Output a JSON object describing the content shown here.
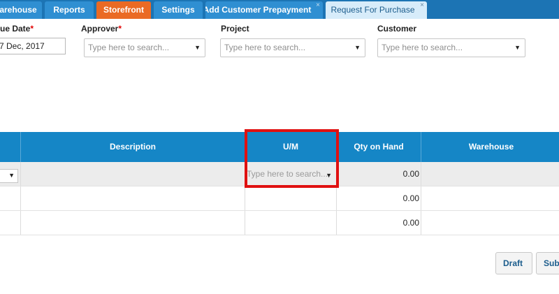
{
  "tabs": [
    {
      "label": "arehouse",
      "active": false,
      "color": "#2f8fd2"
    },
    {
      "label": "Reports",
      "active": false,
      "color": "#2f8fd2"
    },
    {
      "label": "Storefront",
      "active": false,
      "color": "#ea6a24"
    },
    {
      "label": "Settings",
      "active": false,
      "color": "#2f8fd2"
    },
    {
      "label": "Add Customer Prepayment",
      "active": false,
      "closable": true
    },
    {
      "label": "Request For Purchase",
      "active": true,
      "closable": true
    }
  ],
  "tab_close_glyph": "×",
  "form": {
    "due_date": {
      "label": "ue Date",
      "required_mark": "*",
      "value": "7 Dec, 2017"
    },
    "approver": {
      "label": "Approver",
      "required_mark": "*",
      "placeholder": "Type here to search..."
    },
    "project": {
      "label": "Project",
      "placeholder": "Type here to search..."
    },
    "customer": {
      "label": "Customer",
      "placeholder": "Type here to search..."
    }
  },
  "grid": {
    "columns": [
      "",
      "Description",
      "U/M",
      "Qty on Hand",
      "Warehouse"
    ],
    "rows": [
      {
        "qty_on_hand": "0.00"
      },
      {
        "qty_on_hand": "0.00"
      },
      {
        "qty_on_hand": "0.00"
      }
    ],
    "um_placeholder": "Type here to search..."
  },
  "dropdown_arrow": "▼",
  "buttons": {
    "draft": "Draft",
    "submit": "Sub"
  },
  "colors": {
    "tabbar": "#1c74b4",
    "header": "#1586c6",
    "highlight": "#e01010",
    "required": "#e00000",
    "storefront_tab": "#ea6a24"
  }
}
